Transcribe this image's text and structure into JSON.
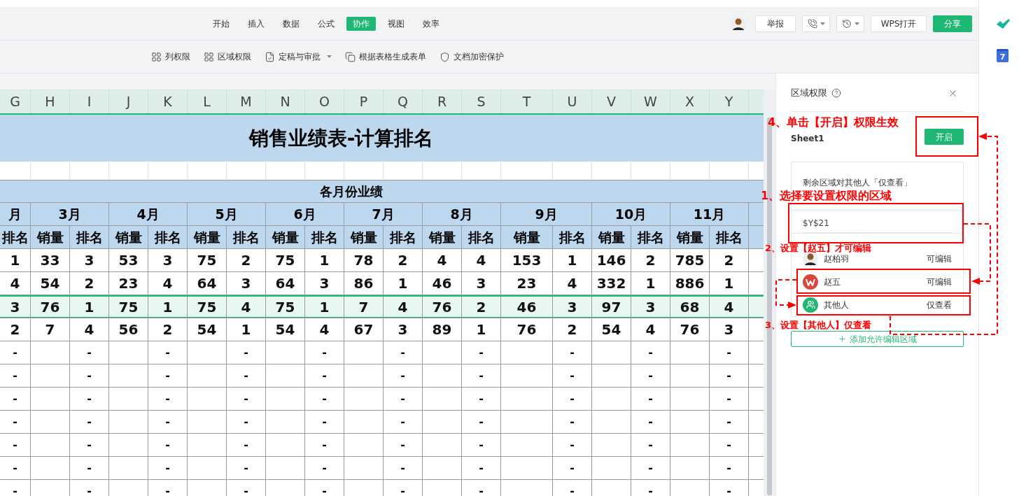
{
  "menu_tabs": [
    {
      "label": "开始",
      "selected": false
    },
    {
      "label": "插入",
      "selected": false
    },
    {
      "label": "数据",
      "selected": false
    },
    {
      "label": "公式",
      "selected": false
    },
    {
      "label": "协作",
      "selected": true
    },
    {
      "label": "视图",
      "selected": false
    },
    {
      "label": "效率",
      "selected": false
    }
  ],
  "top_actions": {
    "report_button": "举报",
    "open_button": "WPS打开",
    "share_button": "分享"
  },
  "toolbar": [
    {
      "label": "列权限",
      "kind": "grid",
      "dropdown": false
    },
    {
      "label": "区域权限",
      "kind": "grid",
      "dropdown": false
    },
    {
      "label": "定稿与审批",
      "kind": "check",
      "dropdown": true
    },
    {
      "label": "根据表格生成表单",
      "kind": "copy",
      "dropdown": false
    },
    {
      "label": "文档加密保护",
      "kind": "shield",
      "dropdown": false
    }
  ],
  "side_strip": {
    "calendar_day": "7"
  },
  "sheet": {
    "columns": [
      "G",
      "H",
      "I",
      "J",
      "K",
      "L",
      "M",
      "N",
      "O",
      "P",
      "Q",
      "R",
      "S",
      "T",
      "U",
      "V",
      "W",
      "X",
      "Y"
    ],
    "title": "销售业绩表-计算排名",
    "group_header": "各月份业绩",
    "months": [
      "月",
      "3月",
      "4月",
      "5月",
      "6月",
      "7月",
      "8月",
      "9月",
      "10月",
      "11月"
    ],
    "subheaders": [
      "排名",
      "销量",
      "排名",
      "销量",
      "排名",
      "销量",
      "排名",
      "销量",
      "排名",
      "销量",
      "排名",
      "销量",
      "排名",
      "销量",
      "排名",
      "销量",
      "排名",
      "销量",
      "排名"
    ],
    "rows": [
      {
        "selected": false,
        "cells": [
          "1",
          "33",
          "3",
          "53",
          "3",
          "75",
          "2",
          "75",
          "1",
          "78",
          "2",
          "4",
          "4",
          "153",
          "1",
          "146",
          "2",
          "785",
          "2"
        ]
      },
      {
        "selected": false,
        "cells": [
          "4",
          "54",
          "2",
          "23",
          "4",
          "64",
          "3",
          "64",
          "3",
          "86",
          "1",
          "46",
          "3",
          "23",
          "4",
          "332",
          "1",
          "886",
          "1"
        ]
      },
      {
        "selected": true,
        "cells": [
          "3",
          "76",
          "1",
          "75",
          "1",
          "75",
          "4",
          "75",
          "1",
          "7",
          "4",
          "76",
          "2",
          "46",
          "3",
          "97",
          "3",
          "68",
          "4"
        ]
      },
      {
        "selected": false,
        "cells": [
          "2",
          "7",
          "4",
          "56",
          "2",
          "54",
          "1",
          "54",
          "4",
          "67",
          "3",
          "89",
          "1",
          "76",
          "2",
          "54",
          "4",
          "76",
          "3"
        ]
      }
    ],
    "blank_rank_rows": [
      [
        "-",
        "-",
        "-",
        "-",
        "-",
        "-",
        "-",
        "-",
        "-",
        "-"
      ],
      [
        "-",
        "-",
        "-",
        "-",
        "-",
        "-",
        "-",
        "-",
        "-",
        "-"
      ],
      [
        "-",
        "-",
        "-",
        "-",
        "-",
        "-",
        "-",
        "-",
        "-",
        "-"
      ],
      [
        "-",
        "-",
        "-",
        "-",
        "-",
        "-",
        "-",
        "-",
        "-",
        "-"
      ],
      [
        "-",
        "-",
        "-",
        "-",
        "-",
        "-",
        "-",
        "-",
        "-",
        "-"
      ],
      [
        "-",
        "-",
        "-",
        "-",
        "-",
        "-",
        "-",
        "-",
        "-",
        "-"
      ],
      [
        "-",
        "-",
        "-",
        "-",
        "-",
        "-",
        "-",
        "-",
        "-",
        "-"
      ]
    ]
  },
  "panel": {
    "title": "区域权限",
    "sheet_name": "Sheet1",
    "enable_button": "开启",
    "remaining_note": "剩余区域对其他人「仅查看」",
    "range": "$Y$21",
    "members": [
      {
        "name": "赵柏羽",
        "permission": "可编辑",
        "kind": "avatar"
      },
      {
        "name": "赵五",
        "permission": "可编辑",
        "kind": "logo"
      },
      {
        "name": "其他人",
        "permission": "仅查看",
        "kind": "group"
      }
    ],
    "add_button": "添加允许编辑区域"
  },
  "annotations": [
    "4、单击【开启】权限生效",
    "1、选择要设置权限的区域",
    "2、设置【赵五】才可编辑",
    "3、设置【其他人】仅查看"
  ]
}
